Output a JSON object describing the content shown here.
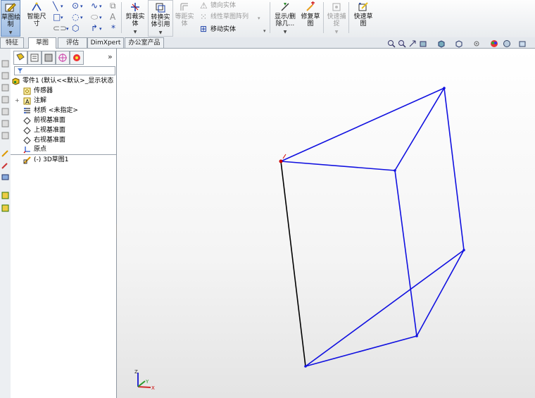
{
  "ribbon": {
    "sketch": "草图绘\n制",
    "smart_dim": "智能尺\n寸",
    "trim": "剪裁实\n体",
    "convert": "转换实\n体引用",
    "offset": "等距实\n体",
    "mirror": "镜向实体",
    "linear_pattern": "线性草图阵列",
    "move": "移动实体",
    "display_delete": "显示/删\n除几...",
    "repair": "修复草\n图",
    "quick_snap": "快速捕\n捉",
    "rapid_sketch": "快速草\n图"
  },
  "tabs": [
    "特征",
    "草图",
    "评估",
    "DimXpert",
    "办公室产品"
  ],
  "tree": {
    "part": "零件1 (默认<<默认>_显示状态",
    "sensors": "传感器",
    "annotations": "注解",
    "material": "材质 <未指定>",
    "front_plane": "前视基准面",
    "top_plane": "上视基准面",
    "right_plane": "右视基准面",
    "origin": "原点",
    "sketch3d": "(-) 3D草图1"
  },
  "panel": {
    "expand": "»"
  },
  "colors": {
    "sketch_line": "#1010e0",
    "selected_line": "#000000",
    "endpoint": "#d00000"
  },
  "triad": {
    "x": "X",
    "y": "Y",
    "z": "Z"
  }
}
